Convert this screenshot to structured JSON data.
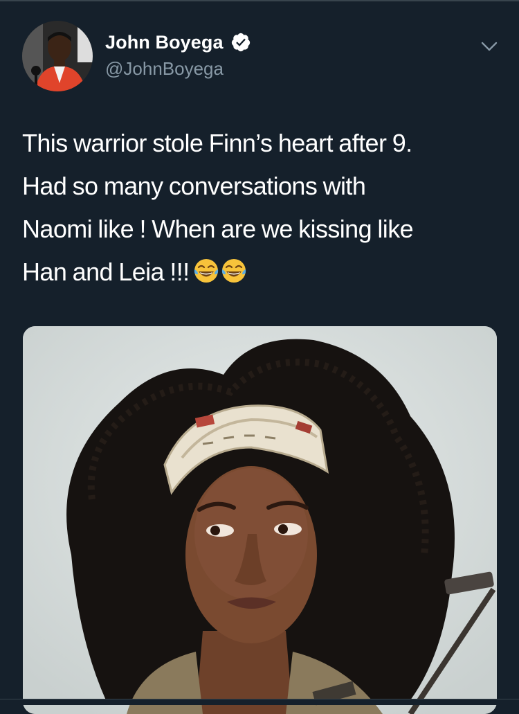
{
  "tweet": {
    "author": {
      "display_name": "John Boyega",
      "handle": "@JohnBoyega",
      "verified": true
    },
    "text_lines": [
      "This warrior stole Finn’s heart after 9.",
      "Had so many conversations with",
      "Naomi like ! When are we kissing like",
      "Han and Leia !!!"
    ],
    "emojis": [
      "face-with-tears-of-joy",
      "face-with-tears-of-joy"
    ],
    "media": {
      "type": "photo",
      "icon": "photo-of-woman-with-goggles"
    }
  },
  "colors": {
    "background": "#15202b",
    "text": "#ffffff",
    "secondary_text": "#8899a6",
    "verified": "#ffffff",
    "border": "#38444d"
  },
  "icons": {
    "verified": "verified-badge-icon",
    "more": "chevron-down-icon",
    "emoji": "tears-of-joy-emoji-icon"
  }
}
